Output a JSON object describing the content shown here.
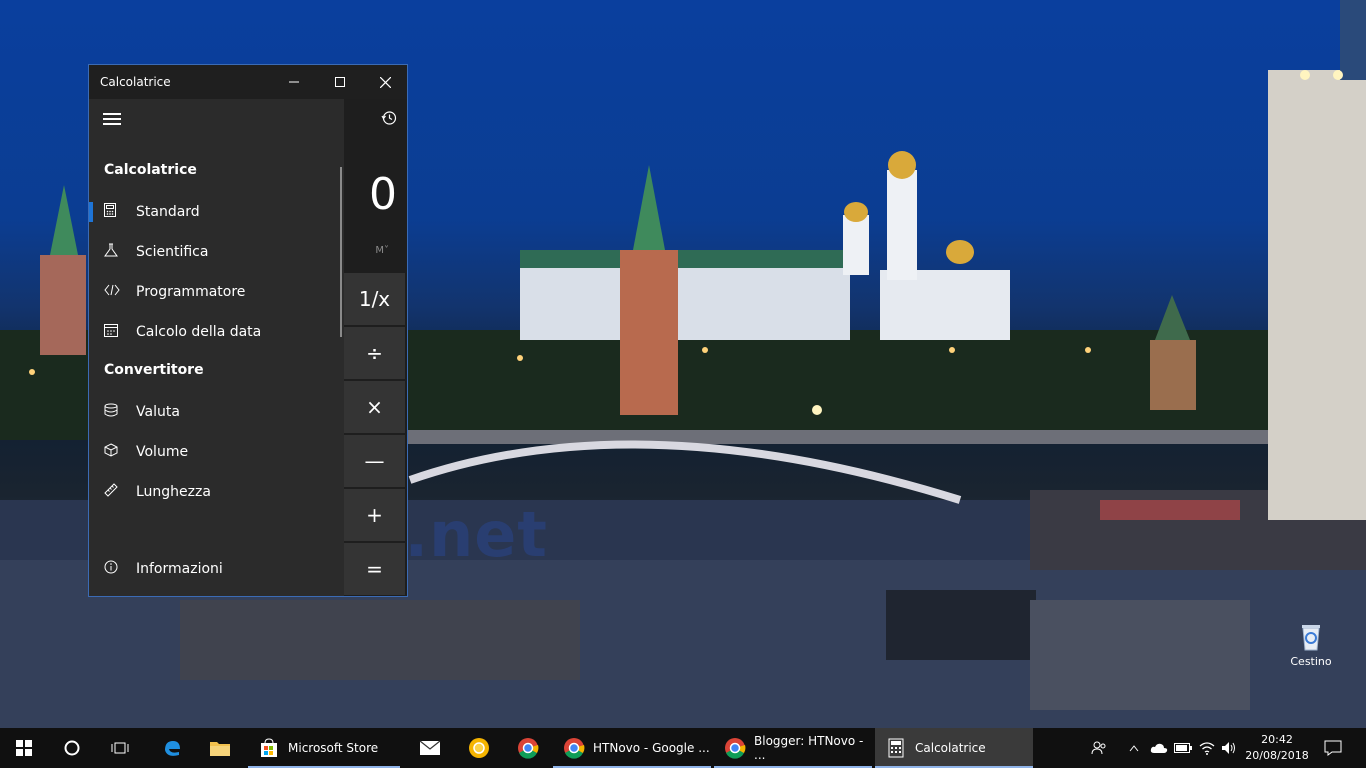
{
  "window": {
    "title": "Calcolatrice",
    "minimize_icon": "minimize-icon",
    "maximize_icon": "maximize-icon",
    "close_icon": "close-icon"
  },
  "nav": {
    "sections": [
      {
        "label": "Calcolatrice"
      },
      {
        "label": "Convertitore"
      }
    ],
    "calc_items": [
      {
        "label": "Standard",
        "icon": "standard-calc-icon",
        "selected": true
      },
      {
        "label": "Scientifica",
        "icon": "flask-icon"
      },
      {
        "label": "Programmatore",
        "icon": "code-icon"
      },
      {
        "label": "Calcolo della data",
        "icon": "calendar-icon"
      }
    ],
    "converter_items": [
      {
        "label": "Valuta",
        "icon": "currency-icon"
      },
      {
        "label": "Volume",
        "icon": "cube-icon"
      },
      {
        "label": "Lunghezza",
        "icon": "ruler-icon"
      }
    ],
    "about": {
      "label": "Informazioni",
      "icon": "info-icon"
    }
  },
  "calculator": {
    "display": "0",
    "memory": "M˅",
    "keys": [
      "1/x",
      "÷",
      "×",
      "—",
      "+",
      "="
    ]
  },
  "watermark": "htnovo.net",
  "desktop": {
    "recycle_bin": "Cestino"
  },
  "taskbar": {
    "apps": [
      {
        "label": "Microsoft Store"
      },
      {
        "label": "HTNovo - Google ..."
      },
      {
        "label": "Blogger: HTNovo - ..."
      },
      {
        "label": "Calcolatrice"
      }
    ],
    "time": "20:42",
    "date": "20/08/2018"
  },
  "colors": {
    "accent": "#1e74d6",
    "window_border": "#3b6bb5",
    "taskbar": "#101010"
  }
}
